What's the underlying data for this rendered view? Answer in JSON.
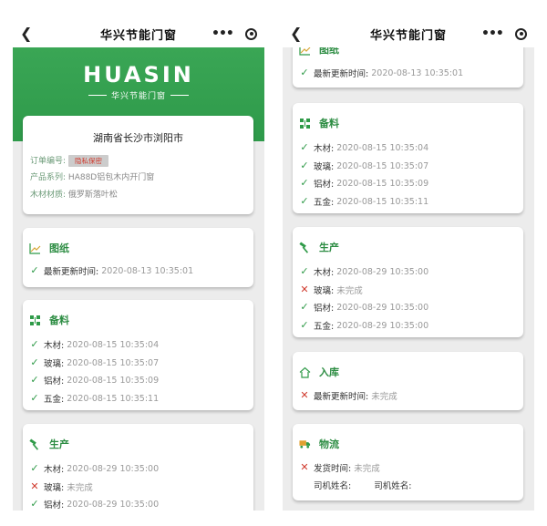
{
  "nav_title": "华兴节能门窗",
  "banner": {
    "logo": "HUASIN",
    "tagline": "华兴节能门窗"
  },
  "order": {
    "address": "湖南省长沙市浏阳市",
    "order_no_label": "订单编号:",
    "order_no_value": "隐私保密",
    "series_label": "产品系列:",
    "series_value": "HA88D铝包木内开门窗",
    "wood_label": "木材材质:",
    "wood_value": "俄罗斯落叶松"
  },
  "drawing": {
    "title": "图纸",
    "icon": "chart-icon",
    "rows": [
      {
        "label": "最新更新时间:",
        "value": "2020-08-13 10:35:01",
        "status": "ok"
      }
    ]
  },
  "materials": {
    "title": "备料",
    "icon": "grid-icon",
    "rows": [
      {
        "label": "木材:",
        "value": "2020-08-15 10:35:04",
        "status": "ok"
      },
      {
        "label": "玻璃:",
        "value": "2020-08-15 10:35:07",
        "status": "ok"
      },
      {
        "label": "铝材:",
        "value": "2020-08-15 10:35:09",
        "status": "ok"
      },
      {
        "label": "五金:",
        "value": "2020-08-15 10:35:11",
        "status": "ok"
      }
    ]
  },
  "production": {
    "title": "生产",
    "icon": "hammer-icon",
    "rows": [
      {
        "label": "木材:",
        "value": "2020-08-29 10:35:00",
        "status": "ok"
      },
      {
        "label": "玻璃:",
        "value": "未完成",
        "status": "no"
      },
      {
        "label": "铝材:",
        "value": "2020-08-29 10:35:00",
        "status": "ok"
      },
      {
        "label": "五金:",
        "value": "2020-08-29 10:35:00",
        "status": "ok"
      }
    ]
  },
  "storage": {
    "title": "入库",
    "icon": "house-icon",
    "rows": [
      {
        "label": "最新更新时间:",
        "value": "未完成",
        "status": "no"
      }
    ]
  },
  "logistics": {
    "title": "物流",
    "icon": "truck-icon",
    "rows": [
      {
        "label": "发货时间:",
        "value": "未完成",
        "status": "no"
      }
    ],
    "driver_label_1": "司机姓名:",
    "driver_label_2": "司机姓名:"
  },
  "colors": {
    "accent": "#2f9a48",
    "fail": "#d03a2d",
    "background": "#ececec"
  }
}
